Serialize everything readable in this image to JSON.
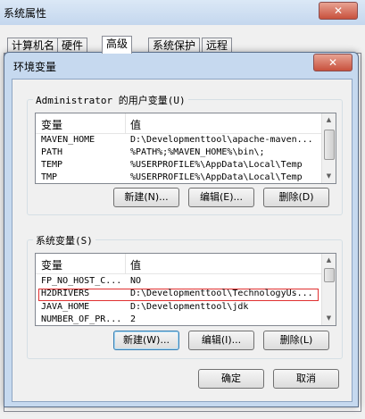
{
  "outer_window": {
    "title": "系统属性",
    "close_glyph": "✕"
  },
  "tabs": [
    {
      "label": "计算机名"
    },
    {
      "label": "硬件"
    },
    {
      "label": "高级"
    },
    {
      "label": "系统保护"
    },
    {
      "label": "远程"
    }
  ],
  "dialog": {
    "title": "环境变量",
    "close_glyph": "✕"
  },
  "user_vars": {
    "group_label": "Administrator 的用户变量(U)",
    "col_name": "变量",
    "col_value": "值",
    "rows": [
      {
        "name": "MAVEN_HOME",
        "value": "D:\\Developmenttool\\apache-maven..."
      },
      {
        "name": "PATH",
        "value": "%PATH%;%MAVEN_HOME%\\bin\\;"
      },
      {
        "name": "TEMP",
        "value": "%USERPROFILE%\\AppData\\Local\\Temp"
      },
      {
        "name": "TMP",
        "value": "%USERPROFILE%\\AppData\\Local\\Temp"
      }
    ],
    "new_label": "新建(N)...",
    "edit_label": "编辑(E)...",
    "delete_label": "删除(D)"
  },
  "system_vars": {
    "group_label": "系统变量(S)",
    "col_name": "变量",
    "col_value": "值",
    "rows": [
      {
        "name": "FP_NO_HOST_C...",
        "value": "NO"
      },
      {
        "name": "H2DRIVERS",
        "value": "D:\\Developmenttool\\TechnologyUs..."
      },
      {
        "name": "JAVA_HOME",
        "value": "D:\\Developmenttool\\jdk"
      },
      {
        "name": "NUMBER_OF_PR...",
        "value": "2"
      }
    ],
    "new_label": "新建(W)...",
    "edit_label": "编辑(I)...",
    "delete_label": "删除(L)"
  },
  "footer": {
    "ok_label": "确定",
    "cancel_label": "取消"
  },
  "scroll_glyphs": {
    "up": "▲",
    "down": "▼"
  },
  "colors": {
    "selection_outline": "#e03030",
    "dialog_frame": "#c6d9ef",
    "close_button": "#c8513d"
  }
}
